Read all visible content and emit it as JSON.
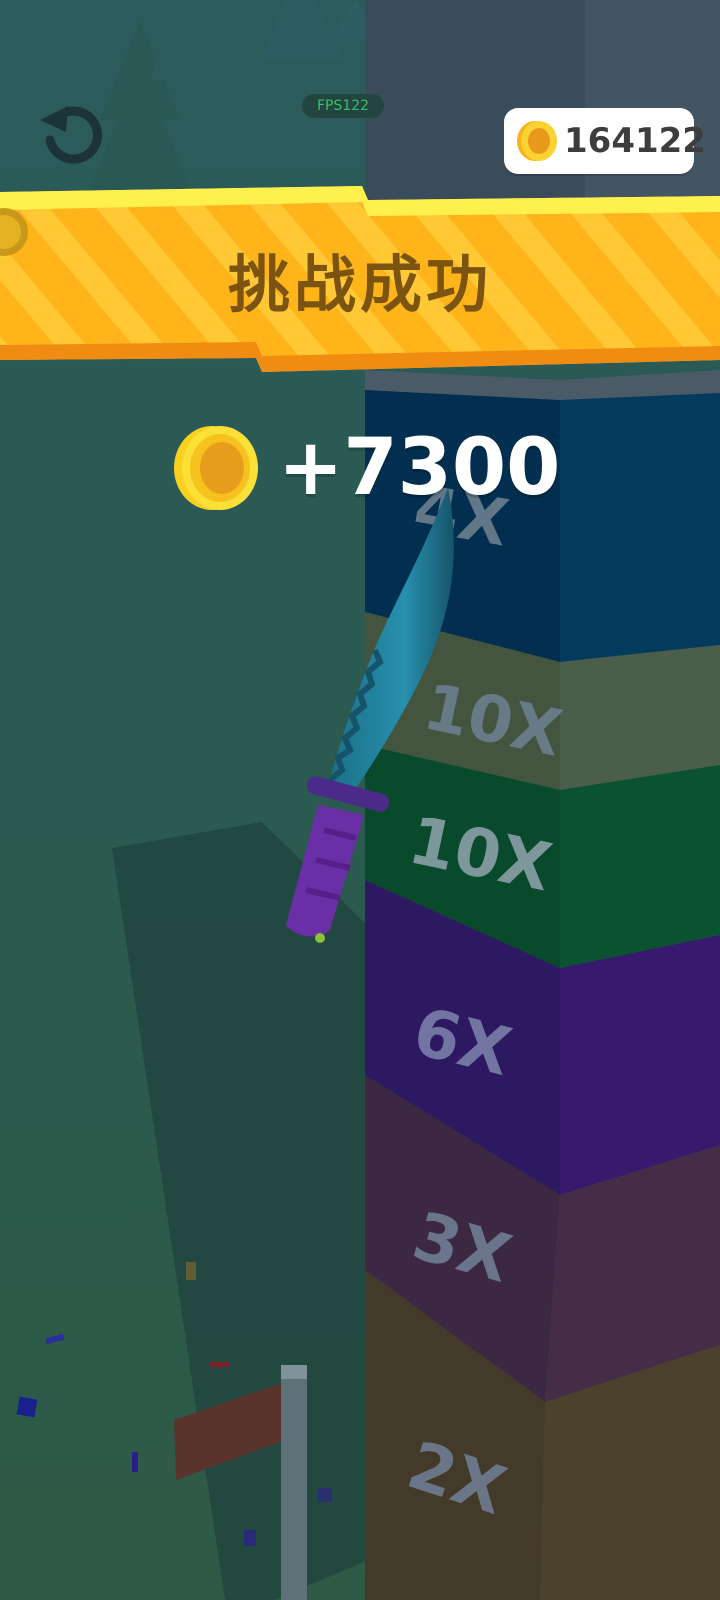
{
  "hud": {
    "fps_label": "FPS122",
    "coin_count": "164122",
    "coin_icon": "gold-coin-icon",
    "undo_icon": "undo-arrow-icon",
    "left_badge_icon": "coin-badge-icon"
  },
  "banner": {
    "title": "挑战成功"
  },
  "reward": {
    "amount_text": "+7300",
    "coin_icon": "gold-coin-icon"
  },
  "tower": {
    "segments": [
      {
        "label": "4X",
        "color": "#023a5e"
      },
      {
        "label": "10X",
        "color": "#4b5e4a"
      },
      {
        "label": "10X",
        "color": "#0a5330"
      },
      {
        "label": "6X",
        "color": "#341c6b"
      },
      {
        "label": "3X",
        "color": "#452d48"
      },
      {
        "label": "2X",
        "color": "#4b412d"
      }
    ]
  },
  "colors": {
    "banner_yellow": "#ffc21a",
    "banner_orange": "#ffa21c",
    "coin_gold": "#fbc91c",
    "coin_dark": "#e59d1b",
    "background": "#2f5f58",
    "knife_blade": "#1f7e98",
    "knife_handle": "#6a2ea6"
  }
}
